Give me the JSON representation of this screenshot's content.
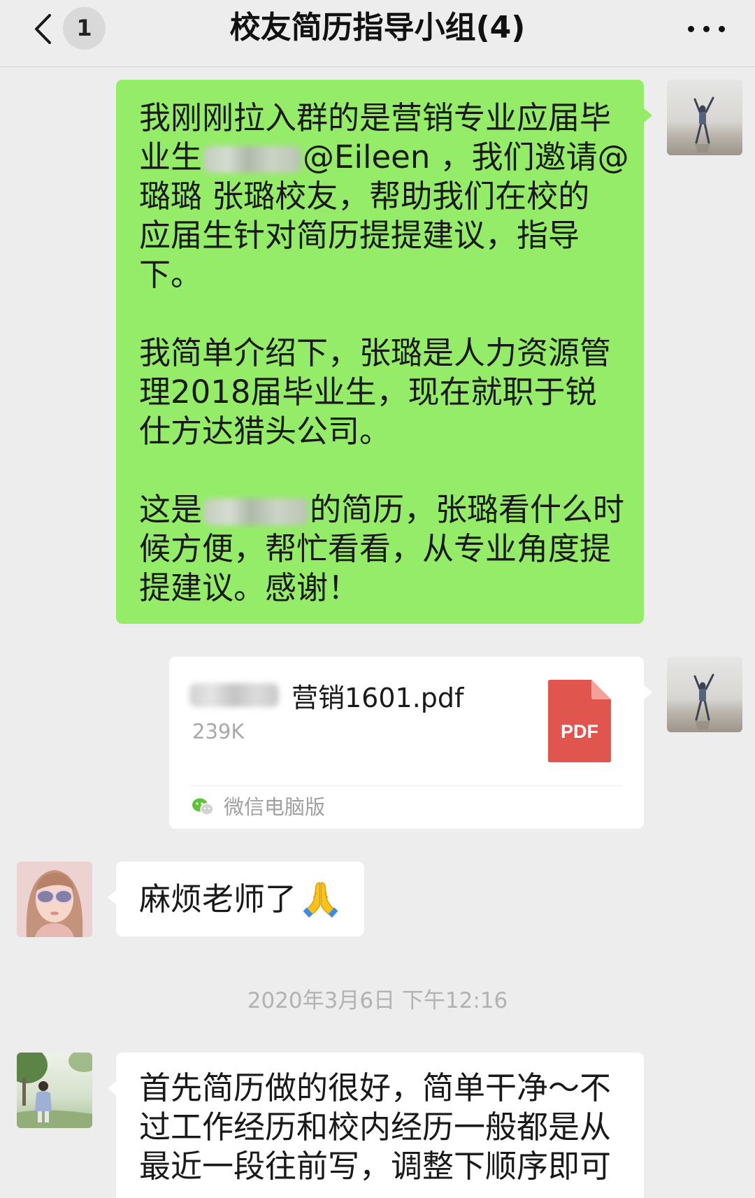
{
  "header": {
    "back_icon": "chevron-left-icon",
    "badge_count": "1",
    "title": "校友简历指导小组(4)",
    "more_icon": "more-dots-icon"
  },
  "colors": {
    "background": "#ededed",
    "self_bubble": "#95ec69",
    "other_bubble": "#ffffff",
    "pdf_icon": "#e0564f",
    "secondary_text": "#a6a6a6"
  },
  "chat": {
    "messages": [
      {
        "sender": "self",
        "type": "text",
        "paragraphs": [
          [
            "我刚刚拉入群的是营销专业应届毕",
            {
              "before": "业生",
              "after": "@Eileen ，我们邀请@"
            },
            "璐璐 张璐校友，帮助我们在校的",
            "应届生针对简历提提建议，指导",
            "下。"
          ],
          [
            "我简单介绍下，张璐是人力资源管",
            "理2018届毕业生，现在就职于锐",
            "仕方达猎头公司。"
          ],
          [
            {
              "before": "这是",
              "after": "的简历，张璐看什么时"
            },
            "候方便，帮忙看看，从专业角度提",
            "提建议。感谢！"
          ]
        ]
      },
      {
        "sender": "self",
        "type": "file",
        "file": {
          "name": "营销1601.pdf",
          "size": "239K",
          "type_label": "PDF",
          "source": "微信电脑版",
          "source_icon": "wechat-icon"
        }
      },
      {
        "sender": "other",
        "type": "text",
        "text": "麻烦老师了",
        "emoji_icon": "folded-hands-icon"
      },
      {
        "type": "time",
        "text": "2020年3月6日 下午12:16"
      },
      {
        "sender": "other",
        "type": "text",
        "lines": [
          "首先简历做的很好，简单干净～不",
          "过工作经历和校内经历一般都是从",
          "最近一段往前写，调整下顺序即可"
        ]
      }
    ]
  }
}
